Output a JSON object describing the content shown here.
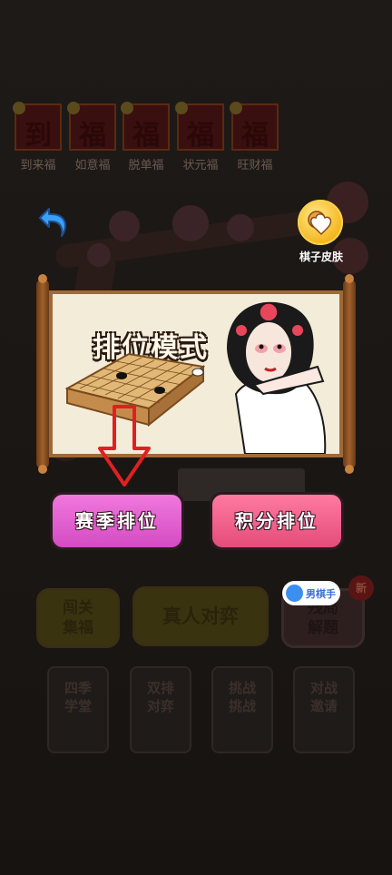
{
  "fu_cards": [
    {
      "glyph": "到",
      "label": "到来福"
    },
    {
      "glyph": "福",
      "label": "如意福"
    },
    {
      "glyph": "福",
      "label": "脱单福"
    },
    {
      "glyph": "福",
      "label": "状元福"
    },
    {
      "glyph": "福",
      "label": "旺财福"
    }
  ],
  "background_menu": {
    "row1": [
      {
        "label": "闯关\n集福"
      },
      {
        "label": "真人对弈"
      },
      {
        "label": "残局\n解题"
      }
    ],
    "new_badge": "新",
    "row2": [
      {
        "label": "四季\n学堂"
      },
      {
        "label": "双排\n对弈"
      },
      {
        "label": "挑战\n挑战"
      },
      {
        "label": "对战\n邀请"
      }
    ]
  },
  "popup": {
    "skin_label": "棋子皮肤",
    "mode_title": "排位模式",
    "season_button": "赛季排位",
    "points_button": "积分排位",
    "gender_toggle": "男棋手"
  },
  "colors": {
    "season_button": "#e864d5",
    "points_button": "#f0648f",
    "hint_arrow": "#e02020",
    "skin_gold": "#f3b51c"
  },
  "icons": {
    "back": "back-arrow-icon",
    "skin": "heart-chess-icon",
    "hint": "down-arrow-hint-icon"
  }
}
